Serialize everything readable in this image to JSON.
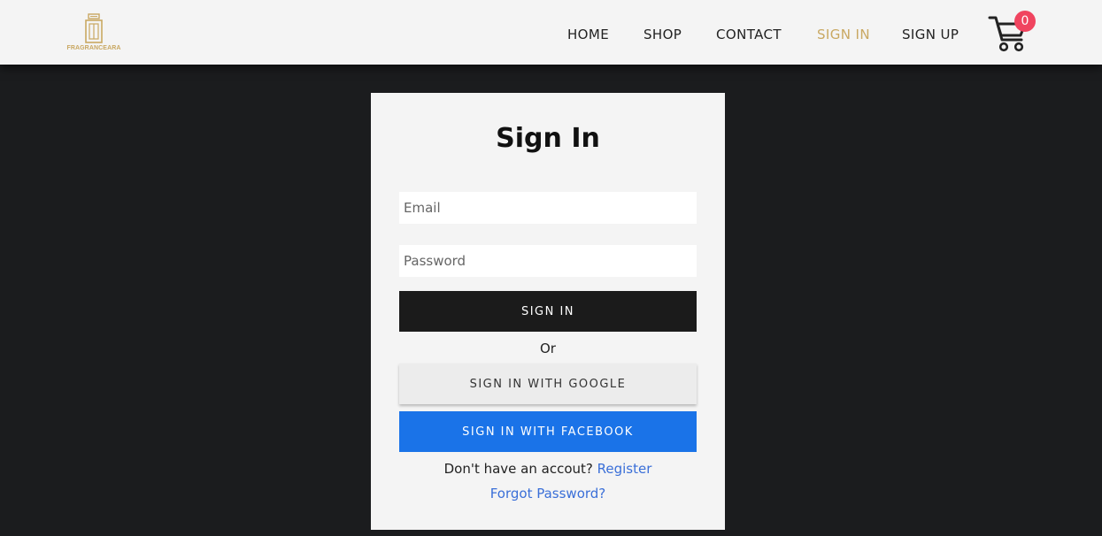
{
  "brand": {
    "logo_text": "FRAGRANCEARA",
    "accent_color": "#c9a862"
  },
  "nav": {
    "items": [
      {
        "label": "HOME",
        "active": false
      },
      {
        "label": "SHOP",
        "active": false
      },
      {
        "label": "CONTACT",
        "active": false
      },
      {
        "label": "SIGN IN",
        "active": true
      },
      {
        "label": "SIGN UP",
        "active": false
      }
    ],
    "cart_icon": "shopping-cart-icon",
    "cart_count": "0",
    "cart_badge_color": "#f0445f"
  },
  "signin": {
    "title": "Sign In",
    "email_placeholder": "Email",
    "email_value": "",
    "password_placeholder": "Password",
    "password_value": "",
    "submit_label": "SIGN IN",
    "or_text": "Or",
    "google_label": "SIGN IN WITH GOOGLE",
    "facebook_label": "SIGN IN WITH FACEBOOK",
    "facebook_color": "#1a73e8",
    "no_account_text": "Don't have an accout?",
    "register_link": "Register",
    "forgot_link": "Forgot Password?"
  }
}
